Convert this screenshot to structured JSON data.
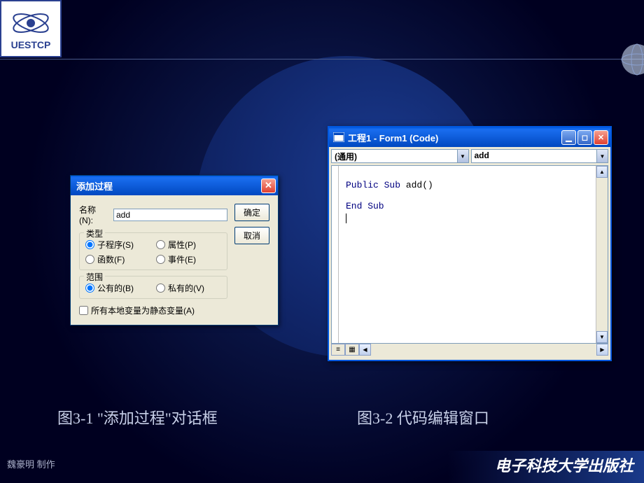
{
  "logo_text": "UESTCP",
  "dialog": {
    "title": "添加过程",
    "name_label": "名称(N):",
    "name_value": "add",
    "type_group": "类型",
    "type_sub": "子程序(S)",
    "type_func": "函数(F)",
    "type_prop": "属性(P)",
    "type_event": "事件(E)",
    "scope_group": "范围",
    "scope_public": "公有的(B)",
    "scope_private": "私有的(V)",
    "static_check": "所有本地变量为静态变量(A)",
    "ok": "确定",
    "cancel": "取消"
  },
  "code_window": {
    "title": "工程1 - Form1 (Code)",
    "left_dropdown": "(通用)",
    "right_dropdown": "add",
    "code_line1_kw": "Public Sub",
    "code_line1_name": " add()",
    "code_line2": "End Sub"
  },
  "caption1": "图3-1  \"添加过程\"对话框",
  "caption2": "图3-2  代码编辑窗口",
  "footer_left": "魏豪明 制作",
  "footer_right": "电子科技大学出版社"
}
